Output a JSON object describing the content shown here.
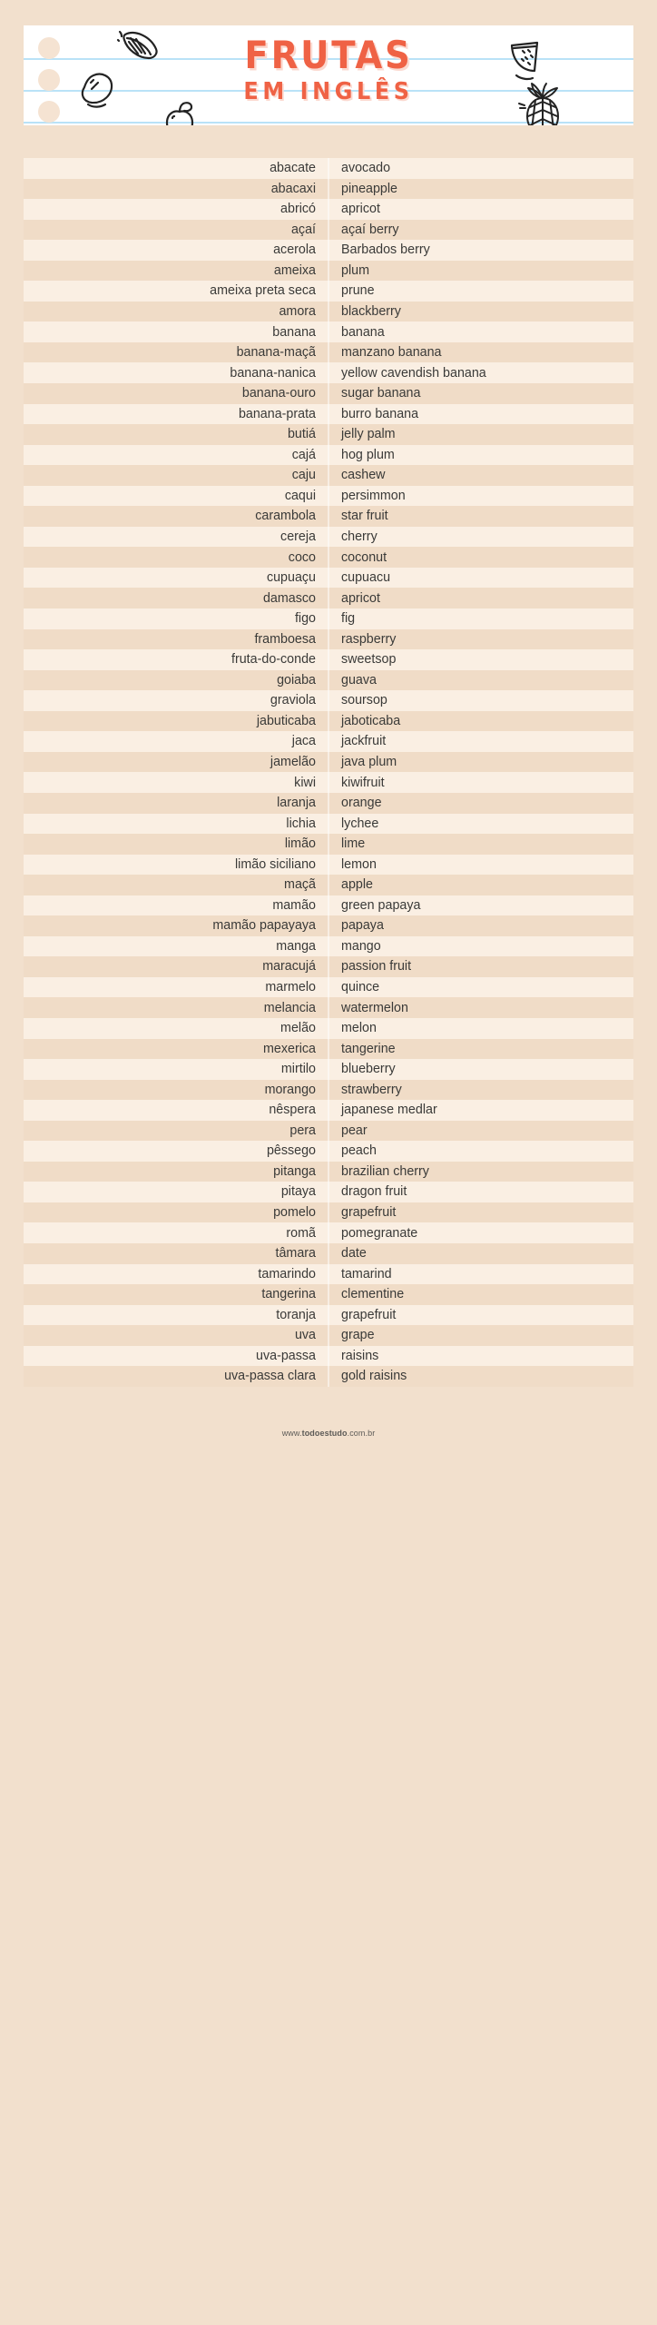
{
  "header": {
    "title_main": "FRUTAS",
    "title_sub": "EM INGLÊS",
    "accent_color": "#ef6245",
    "paper_color": "#ffffff",
    "background_color": "#f2e0cd",
    "rule_line_color": "#b9e2f7",
    "doodles": [
      "orange-slice-doodle",
      "lemon-doodle",
      "apple-doodle",
      "watermelon-slice-doodle",
      "pineapple-doodle"
    ]
  },
  "table": {
    "row_color_odd": "#faefe3",
    "row_color_even": "#f0dcc7",
    "rows": [
      {
        "pt": "abacate",
        "en": "avocado"
      },
      {
        "pt": "abacaxi",
        "en": "pineapple"
      },
      {
        "pt": "abricó",
        "en": "apricot"
      },
      {
        "pt": "açaí",
        "en": "açaí berry"
      },
      {
        "pt": "acerola",
        "en": "Barbados berry"
      },
      {
        "pt": "ameixa",
        "en": "plum"
      },
      {
        "pt": "ameixa preta seca",
        "en": "prune"
      },
      {
        "pt": "amora",
        "en": "blackberry"
      },
      {
        "pt": "banana",
        "en": "banana"
      },
      {
        "pt": "banana-maçã",
        "en": "manzano banana"
      },
      {
        "pt": "banana-nanica",
        "en": "yellow cavendish banana"
      },
      {
        "pt": "banana-ouro",
        "en": "sugar banana"
      },
      {
        "pt": "banana-prata",
        "en": "burro banana"
      },
      {
        "pt": "butiá",
        "en": "jelly palm"
      },
      {
        "pt": "cajá",
        "en": "hog plum"
      },
      {
        "pt": "caju",
        "en": "cashew"
      },
      {
        "pt": "caqui",
        "en": "persimmon"
      },
      {
        "pt": "carambola",
        "en": "star fruit"
      },
      {
        "pt": "cereja",
        "en": "cherry"
      },
      {
        "pt": "coco",
        "en": "coconut"
      },
      {
        "pt": "cupuaçu",
        "en": "cupuacu"
      },
      {
        "pt": "damasco",
        "en": "apricot"
      },
      {
        "pt": "figo",
        "en": "fig"
      },
      {
        "pt": "framboesa",
        "en": "raspberry"
      },
      {
        "pt": "fruta-do-conde",
        "en": "sweetsop"
      },
      {
        "pt": "goiaba",
        "en": "guava"
      },
      {
        "pt": "graviola",
        "en": "soursop"
      },
      {
        "pt": "jabuticaba",
        "en": "jaboticaba"
      },
      {
        "pt": "jaca",
        "en": "jackfruit"
      },
      {
        "pt": "jamelão",
        "en": "java plum"
      },
      {
        "pt": "kiwi",
        "en": "kiwifruit"
      },
      {
        "pt": "laranja",
        "en": "orange"
      },
      {
        "pt": "lichia",
        "en": "lychee"
      },
      {
        "pt": "limão",
        "en": "lime"
      },
      {
        "pt": "limão siciliano",
        "en": "lemon"
      },
      {
        "pt": "maçã",
        "en": "apple"
      },
      {
        "pt": "mamão",
        "en": "green papaya"
      },
      {
        "pt": "mamão papayaya",
        "en": "papaya"
      },
      {
        "pt": "manga",
        "en": "mango"
      },
      {
        "pt": "maracujá",
        "en": "passion fruit"
      },
      {
        "pt": "marmelo",
        "en": "quince"
      },
      {
        "pt": "melancia",
        "en": "watermelon"
      },
      {
        "pt": "melão",
        "en": "melon"
      },
      {
        "pt": "mexerica",
        "en": "tangerine"
      },
      {
        "pt": "mirtilo",
        "en": "blueberry"
      },
      {
        "pt": "morango",
        "en": "strawberry"
      },
      {
        "pt": "nêspera",
        "en": "japanese medlar"
      },
      {
        "pt": "pera",
        "en": "pear"
      },
      {
        "pt": "pêssego",
        "en": "peach"
      },
      {
        "pt": "pitanga",
        "en": "brazilian cherry"
      },
      {
        "pt": "pitaya",
        "en": "dragon fruit"
      },
      {
        "pt": "pomelo",
        "en": "grapefruit"
      },
      {
        "pt": "romã",
        "en": "pomegranate"
      },
      {
        "pt": "tâmara",
        "en": "date"
      },
      {
        "pt": "tamarindo",
        "en": "tamarind"
      },
      {
        "pt": "tangerina",
        "en": "clementine"
      },
      {
        "pt": "toranja",
        "en": "grapefruit"
      },
      {
        "pt": "uva",
        "en": "grape"
      },
      {
        "pt": "uva-passa",
        "en": "raisins"
      },
      {
        "pt": "uva-passa clara",
        "en": "gold raisins"
      }
    ]
  },
  "footer": {
    "prefix": "www.",
    "brand": "todoestudo",
    "suffix": ".com.br"
  }
}
